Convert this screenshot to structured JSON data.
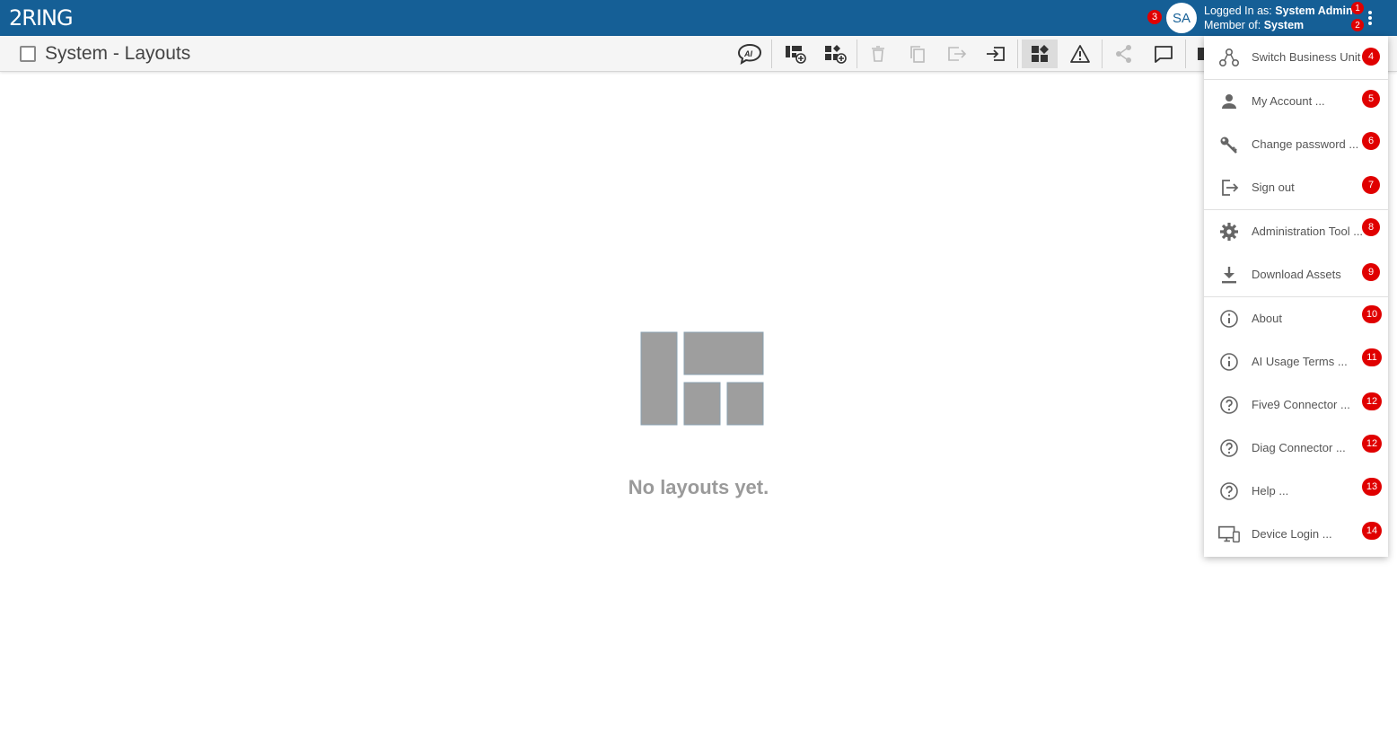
{
  "header": {
    "logo_text": "2RING",
    "avatar_initials": "SA",
    "logged_in_prefix": "Logged In as: ",
    "logged_in_user": "System Admin",
    "member_prefix": "Member of: ",
    "member_unit": "System",
    "brand_color": "#155f96"
  },
  "badges": {
    "logged_in": "1",
    "member": "2",
    "avatar": "3"
  },
  "toolbar": {
    "title": "System - Layouts"
  },
  "empty_state": {
    "message": "No layouts yet."
  },
  "menu": {
    "items": [
      {
        "label": "Switch Business Unit",
        "badge": "4",
        "icon": "switch-business-unit-icon"
      },
      {
        "label": "My Account ...",
        "badge": "5",
        "icon": "person-icon"
      },
      {
        "label": "Change password ...",
        "badge": "6",
        "icon": "key-icon"
      },
      {
        "label": "Sign out",
        "badge": "7",
        "icon": "sign-out-icon"
      },
      {
        "label": "Administration Tool ...",
        "badge": "8",
        "icon": "gear-icon"
      },
      {
        "label": "Download Assets",
        "badge": "9",
        "icon": "download-icon"
      },
      {
        "label": "About",
        "badge": "10",
        "icon": "info-icon"
      },
      {
        "label": "AI Usage Terms ...",
        "badge": "11",
        "icon": "info-icon"
      },
      {
        "label": "Five9 Connector ...",
        "badge": "12",
        "icon": "help-icon"
      },
      {
        "label": "Diag Connector ...",
        "badge": "12",
        "icon": "help-icon"
      },
      {
        "label": "Help ...",
        "badge": "13",
        "icon": "help-icon"
      },
      {
        "label": "Device Login ...",
        "badge": "14",
        "icon": "device-login-icon"
      }
    ]
  },
  "colors": {
    "badge": "#e00000",
    "toolbar_bg": "#f5f5f5",
    "empty_gray": "#9a9a9a"
  }
}
